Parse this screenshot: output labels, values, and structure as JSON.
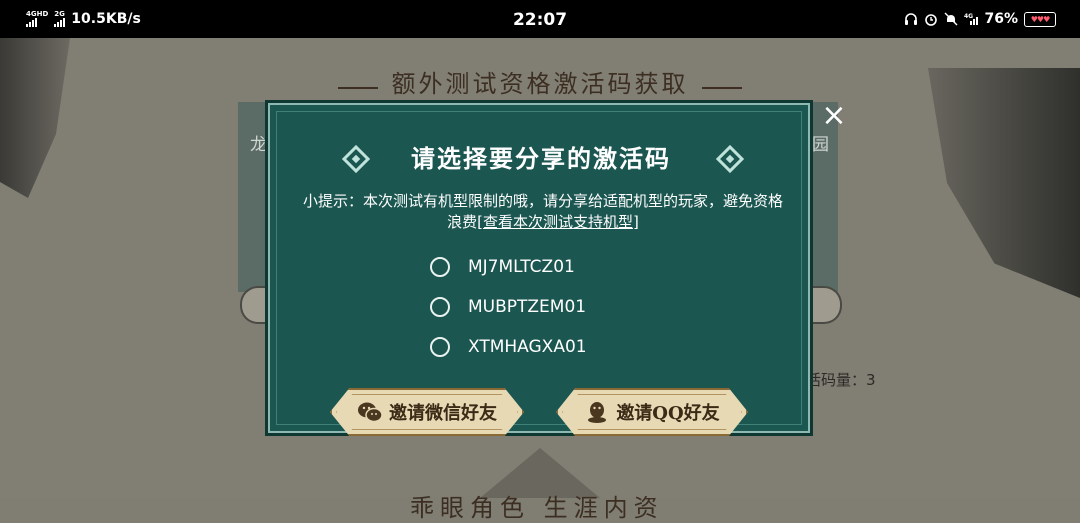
{
  "status_bar": {
    "network_1": "4GHD",
    "network_2": "2G",
    "speed": "10.5KB/s",
    "time": "22:07",
    "battery": "76%",
    "icons": [
      "headphones-icon",
      "alarm-icon",
      "mute-icon",
      "4g-signal-icon",
      "battery-icon"
    ]
  },
  "background": {
    "title": "额外测试资格激活码获取",
    "left_text": "龙",
    "right_text": "园",
    "count_text": "活码量：3",
    "bottom_text": "乖眼角色   生涯内资"
  },
  "modal": {
    "title": "请选择要分享的激活码",
    "hint": "小提示：本次测试有机型限制的哦，请分享给适配机型的玩家，避免资格浪费[",
    "hint_link": "查看本次测试支持机型",
    "hint_end": "]",
    "codes": [
      "MJ7MLTCZ01",
      "MUBPTZEM01",
      "XTMHAGXA01"
    ],
    "buttons": {
      "wechat": "邀请微信好友",
      "qq": "邀请QQ好友"
    },
    "close": "×"
  },
  "colors": {
    "modal_bg": "#1b5650",
    "button_bg": "#e8d9b5",
    "scene_bg": "#817e74"
  }
}
